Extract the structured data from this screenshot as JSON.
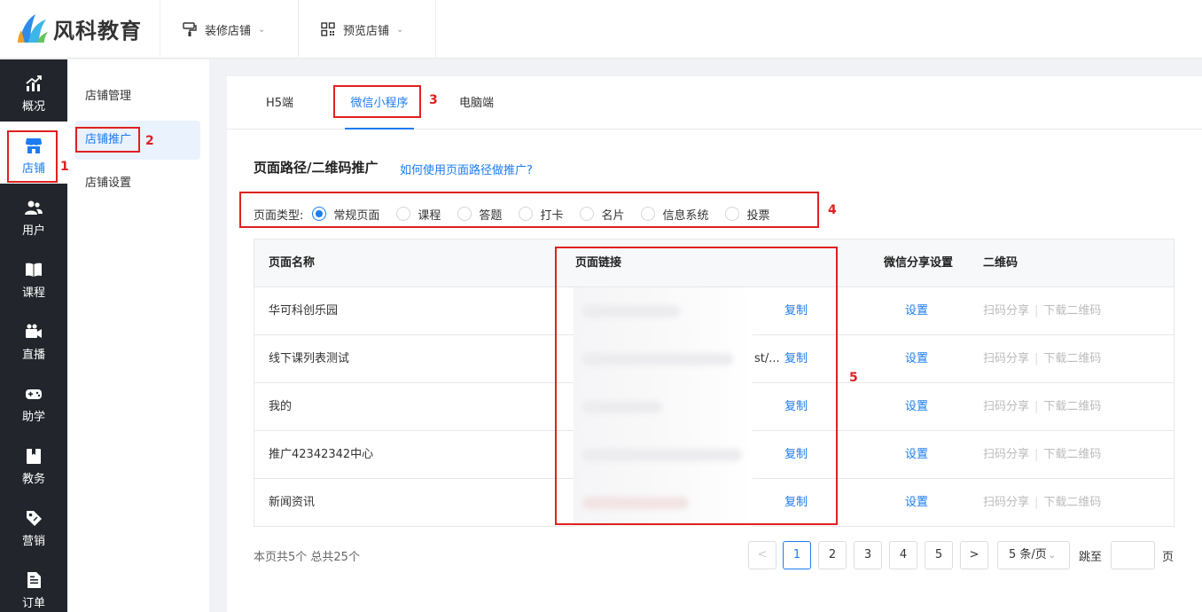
{
  "brand": {
    "name": "风科教育",
    "accent": "#1c7cf2"
  },
  "header": {
    "menus": [
      {
        "label": "装修店铺",
        "icon": "paint-roller-icon"
      },
      {
        "label": "预览店铺",
        "icon": "qrcode-icon"
      }
    ]
  },
  "sidebar": {
    "items": [
      {
        "label": "概况",
        "icon": "chart-icon"
      },
      {
        "label": "店铺",
        "icon": "store-icon",
        "active": true
      },
      {
        "label": "用户",
        "icon": "users-icon"
      },
      {
        "label": "课程",
        "icon": "book-icon"
      },
      {
        "label": "直播",
        "icon": "video-icon"
      },
      {
        "label": "助学",
        "icon": "gamepad-icon"
      },
      {
        "label": "教务",
        "icon": "clipboard-icon"
      },
      {
        "label": "营销",
        "icon": "tag-icon"
      },
      {
        "label": "订单",
        "icon": "document-icon"
      }
    ]
  },
  "subnav": {
    "items": [
      {
        "label": "店铺管理"
      },
      {
        "label": "店铺推广",
        "active": true
      },
      {
        "label": "店铺设置"
      }
    ]
  },
  "tabs": [
    {
      "label": "H5端"
    },
    {
      "label": "微信小程序",
      "active": true
    },
    {
      "label": "电脑端"
    }
  ],
  "section": {
    "title": "页面路径/二维码推广",
    "help_link": "如何使用页面路径做推广?"
  },
  "page_type": {
    "label": "页面类型:",
    "options": [
      "常规页面",
      "课程",
      "答题",
      "打卡",
      "名片",
      "信息系统",
      "投票"
    ],
    "selected": "常规页面"
  },
  "table": {
    "headers": [
      "页面名称",
      "页面链接",
      "微信分享设置",
      "二维码"
    ],
    "rows": [
      {
        "name": "华可科创乐园",
        "link_tail": "",
        "copy": "复制",
        "share": "设置",
        "qr_share": "扫码分享",
        "qr_download": "下载二维码"
      },
      {
        "name": "线下课列表测试",
        "link_tail": "st/...",
        "copy": "复制",
        "share": "设置",
        "qr_share": "扫码分享",
        "qr_download": "下载二维码"
      },
      {
        "name": "我的",
        "link_tail": "",
        "copy": "复制",
        "share": "设置",
        "qr_share": "扫码分享",
        "qr_download": "下载二维码"
      },
      {
        "name": "推广42342342中心",
        "link_tail": "",
        "copy": "复制",
        "share": "设置",
        "qr_share": "扫码分享",
        "qr_download": "下载二维码"
      },
      {
        "name": "新闻资讯",
        "link_tail": "",
        "copy": "复制",
        "share": "设置",
        "qr_share": "扫码分享",
        "qr_download": "下载二维码"
      }
    ]
  },
  "pagination": {
    "summary": "本页共5个 总共25个",
    "prev": "<",
    "next": ">",
    "pages": [
      "1",
      "2",
      "3",
      "4",
      "5"
    ],
    "current": "1",
    "page_size": "5 条/页",
    "jump_label": "跳至",
    "jump_unit": "页"
  },
  "annotations": [
    "1",
    "2",
    "3",
    "4",
    "5"
  ]
}
